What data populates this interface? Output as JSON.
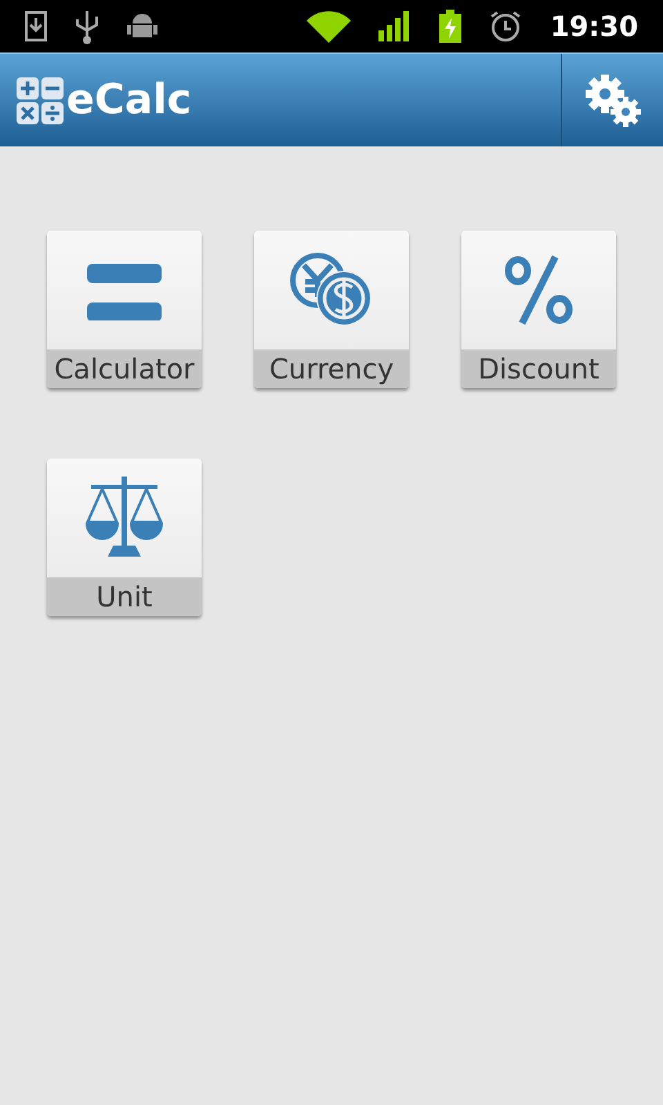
{
  "status_bar": {
    "time": "19:30"
  },
  "action_bar": {
    "title": "eCalc"
  },
  "tiles": [
    {
      "kind": "calculator",
      "label": "Calculator"
    },
    {
      "kind": "currency",
      "label": "Currency"
    },
    {
      "kind": "discount",
      "label": "Discount"
    },
    {
      "kind": "unit",
      "label": "Unit"
    }
  ]
}
